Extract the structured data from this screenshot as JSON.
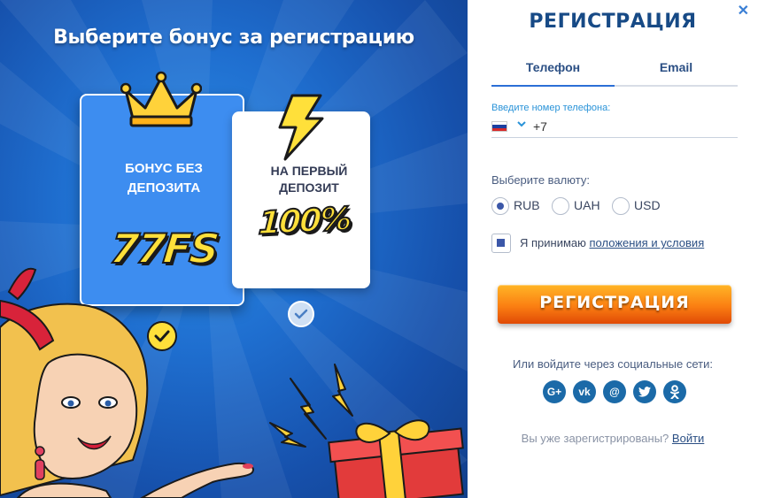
{
  "promo": {
    "title": "Выберите бонус за регистрацию",
    "cards": [
      {
        "label_line1": "БОНУС БЕЗ",
        "label_line2": "ДЕПОЗИТА",
        "amount": "77FS",
        "selected": true
      },
      {
        "label_line1": "НА ПЕРВЫЙ",
        "label_line2": "ДЕПОЗИТ",
        "amount": "100%",
        "selected": false
      }
    ]
  },
  "form": {
    "close_icon": "✕",
    "title": "РЕГИСТРАЦИЯ",
    "tabs": [
      {
        "label": "Телефон",
        "active": true
      },
      {
        "label": "Email",
        "active": false
      }
    ],
    "phone": {
      "label": "Введите номер телефона:",
      "country_icon": "russia-flag-icon",
      "prefix": "+7"
    },
    "currency": {
      "label": "Выберите валюту:",
      "options": [
        {
          "label": "RUB",
          "selected": true
        },
        {
          "label": "UAH",
          "selected": false
        },
        {
          "label": "USD",
          "selected": false
        }
      ]
    },
    "terms": {
      "checked": true,
      "text": "Я принимаю",
      "link": "положения и условия"
    },
    "submit_label": "РЕГИСТРАЦИЯ",
    "social": {
      "label": "Или войдите через социальные сети:",
      "icons": [
        "google-plus-icon",
        "vk-icon",
        "mail-icon",
        "twitter-icon",
        "odnoklassniki-icon"
      ]
    },
    "login": {
      "text": "Вы уже зарегистрированы?",
      "link": "Войти"
    }
  },
  "colors": {
    "accent_blue": "#174a86",
    "button_orange": "#fb7f12",
    "promo_blue": "#1f6fd0",
    "bonus_yellow": "#ffe03a"
  }
}
